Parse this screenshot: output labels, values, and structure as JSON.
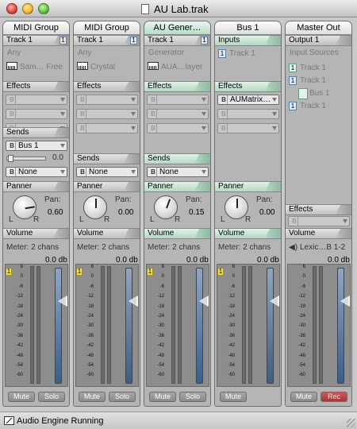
{
  "window": {
    "title": "AU Lab.trak"
  },
  "strips": [
    {
      "header": "MIDI Group",
      "track_label": "Track 1",
      "track_num": "1",
      "source": "Any",
      "instrument": "Sam… Free",
      "effects_label": "Effects",
      "sends_label": "Sends",
      "send1": "Bus 1",
      "send_level": "0.0",
      "send2": "None",
      "panner_label": "Panner",
      "pan_label": "Pan:",
      "pan_value": "0.60",
      "pan_l": "L",
      "pan_r": "R",
      "pan_fraction": 0.6,
      "volume_label": "Volume",
      "meter_label": "Meter: 2 chans",
      "db_value": "0.0 db",
      "chip": "1",
      "btn1": "Mute",
      "btn2": "Solo"
    },
    {
      "header": "MIDI Group",
      "track_label": "Track 1",
      "track_num": "1",
      "source": "Any",
      "instrument": "Crystal",
      "effects_label": "Effects",
      "sends_label": "Sends",
      "send1": "None",
      "panner_label": "Panner",
      "pan_label": "Pan:",
      "pan_value": "0.00",
      "pan_l": "L",
      "pan_r": "R",
      "pan_fraction": 0.0,
      "volume_label": "Volume",
      "meter_label": "Meter: 2 chans",
      "db_value": "0.0 db",
      "chip": "1",
      "btn1": "Mute",
      "btn2": "Solo"
    },
    {
      "header": "AU Gener…",
      "track_label": "Track 1",
      "track_num": "1",
      "source": "Generator",
      "instrument": "AUA…layer",
      "effects_label": "Effects",
      "sends_label": "Sends",
      "send1": "None",
      "panner_label": "Panner",
      "pan_label": "Pan:",
      "pan_value": "0.15",
      "pan_l": "L",
      "pan_r": "R",
      "pan_fraction": 0.15,
      "volume_label": "Volume",
      "meter_label": "Meter: 2 chans",
      "db_value": "0.0 db",
      "chip": "1",
      "btn1": "Mute",
      "btn2": "Solo"
    },
    {
      "header": "Bus 1",
      "inputs_label": "Inputs",
      "input1": "Track 1",
      "input1_num": "1",
      "effects_label": "Effects",
      "effect1": "AUMatrix…",
      "panner_label": "Panner",
      "pan_label": "Pan:",
      "pan_value": "0.00",
      "pan_l": "L",
      "pan_r": "R",
      "pan_fraction": 0.0,
      "volume_label": "Volume",
      "meter_label": "Meter: 2 chans",
      "db_value": "0.0 db",
      "chip": "1",
      "btn1": "Mute"
    },
    {
      "header": "Master Out",
      "output_label": "Output 1",
      "input_sources_label": "Input Sources",
      "sources": [
        {
          "num": "1",
          "label": "Track 1",
          "mint": true
        },
        {
          "num": "1",
          "label": "Track 1",
          "mint": false
        },
        {
          "num": "",
          "label": "Bus 1",
          "mint": true
        },
        {
          "num": "1",
          "label": "Track 1",
          "mint": false
        }
      ],
      "effects_label": "Effects",
      "volume_label": "Volume",
      "device": "Lexic…B 1-2",
      "db_value": "0.0 db",
      "btn1": "Mute",
      "btn2": "Rec"
    }
  ],
  "scale_ticks": [
    "6",
    "0",
    "-6",
    "-12",
    "-18",
    "-24",
    "-30",
    "-36",
    "-42",
    "-48",
    "-54",
    "-60"
  ],
  "status": {
    "text": "Audio Engine Running"
  },
  "colors": {
    "mint_header": "#b8dcc9",
    "fader": "#3b5d8a",
    "rec": "#a53838"
  }
}
